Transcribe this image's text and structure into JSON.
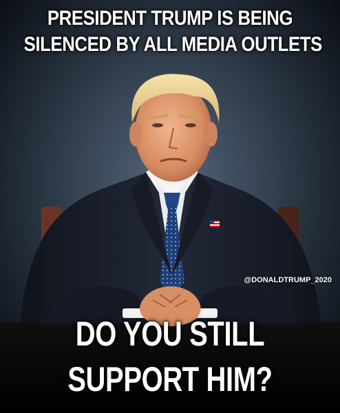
{
  "meme": {
    "top_caption": {
      "line1": "PRESIDENT TRUMP IS BEING",
      "line2": "SILENCED BY ALL MEDIA OUTLETS"
    },
    "watermark": "@DONALDTRUMP_2020",
    "bottom_caption": {
      "line1": "DO YOU STILL",
      "line2": "SUPPORT HIM?"
    }
  },
  "icons": {
    "lapel_pin": "american-flag-icon"
  },
  "colors": {
    "background": "#000000",
    "backdrop": "#3a4a5c",
    "suit": "#1a1f2b",
    "tie": "#1f3f7a",
    "caption_text": "#ffffff"
  }
}
